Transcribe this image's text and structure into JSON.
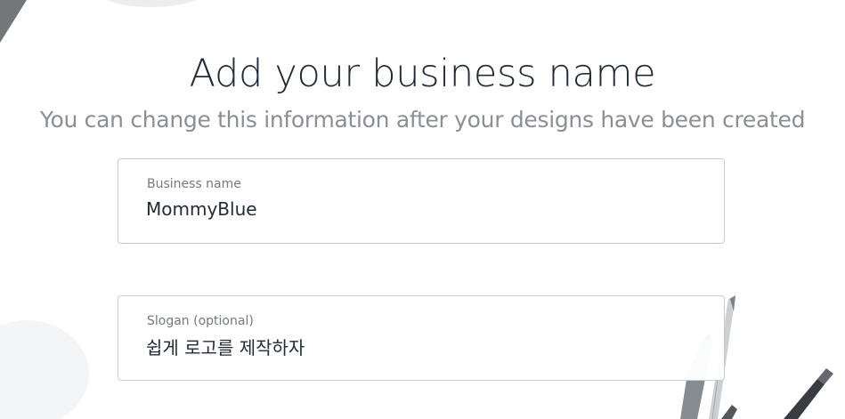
{
  "header": {
    "title": "Add your business name",
    "subtitle": "You can change this information after your designs have been created"
  },
  "form": {
    "business_name": {
      "label": "Business name",
      "value": "MommyBlue"
    },
    "slogan": {
      "label": "Slogan (optional)",
      "value": "쉽게 로고를 제작하자"
    }
  }
}
